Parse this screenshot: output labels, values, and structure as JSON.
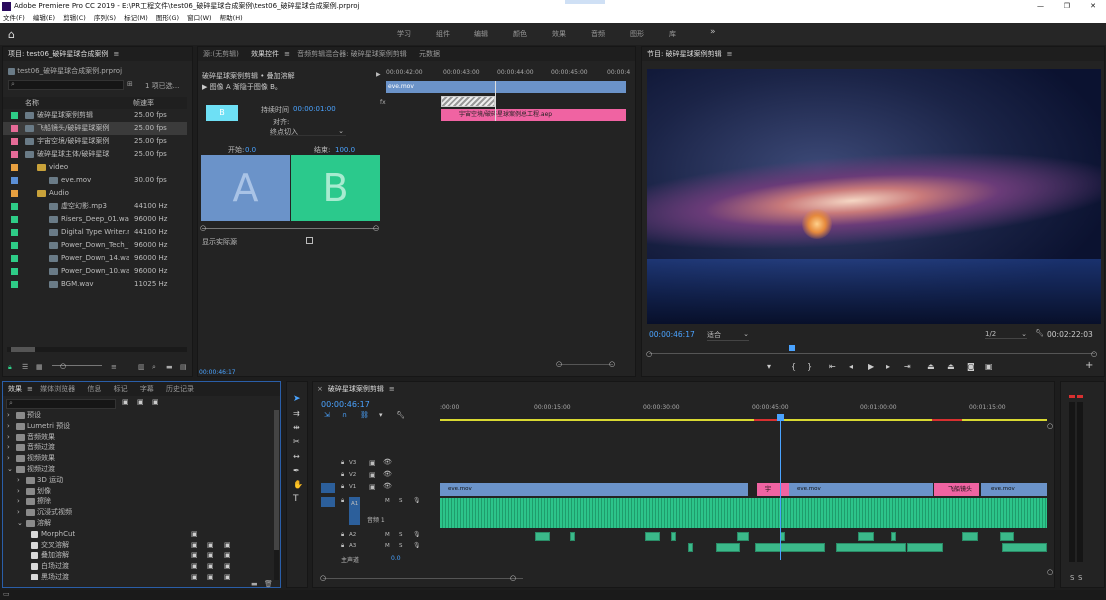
{
  "app": {
    "title": "Adobe Premiere Pro CC 2019 - E:\\PR工程文件\\test06_破碎星球合成案例\\test06_破碎星球合成案例.prproj"
  },
  "menu": [
    "文件(F)",
    "编辑(E)",
    "剪辑(C)",
    "序列(S)",
    "标记(M)",
    "图形(G)",
    "窗口(W)",
    "帮助(H)"
  ],
  "workspaces": [
    "学习",
    "组件",
    "编辑",
    "颜色",
    "效果",
    "音频",
    "图形",
    "库"
  ],
  "project": {
    "title": "项目: test06_破碎星球合成案例",
    "file": "test06_破碎星球合成案例.prproj",
    "count": "1 项已选...",
    "col_name": "名称",
    "col_rate": "帧速率",
    "items": [
      {
        "name": "破碎星球案例剪辑",
        "rate": "25.00 fps",
        "color": "#2ecc87",
        "indent": 0
      },
      {
        "name": "飞船镜头/破碎星球案例",
        "rate": "25.00 fps",
        "color": "#e66b98",
        "indent": 0,
        "selected": true
      },
      {
        "name": "宇宙空境/破碎星球案例",
        "rate": "25.00 fps",
        "color": "#e66b98",
        "indent": 0
      },
      {
        "name": "破碎星球主体/破碎星球",
        "rate": "25.00 fps",
        "color": "#e66b98",
        "indent": 0
      },
      {
        "name": "video",
        "rate": "",
        "color": "#e8a040",
        "indent": 1
      },
      {
        "name": "eve.mov",
        "rate": "30.00 fps",
        "color": "#5b8fd6",
        "indent": 2
      },
      {
        "name": "Audio",
        "rate": "",
        "color": "#e8a040",
        "indent": 1
      },
      {
        "name": "虚空幻影.mp3",
        "rate": "44100 Hz",
        "color": "#2ecc87",
        "indent": 2
      },
      {
        "name": "Risers_Deep_01.wav",
        "rate": "96000 Hz",
        "color": "#2ecc87",
        "indent": 2
      },
      {
        "name": "Digital Type Writer.mp3",
        "rate": "44100 Hz",
        "color": "#2ecc87",
        "indent": 2
      },
      {
        "name": "Power_Down_Tech_10",
        "rate": "96000 Hz",
        "color": "#2ecc87",
        "indent": 2
      },
      {
        "name": "Power_Down_14.wav",
        "rate": "96000 Hz",
        "color": "#2ecc87",
        "indent": 2
      },
      {
        "name": "Power_Down_10.wav",
        "rate": "96000 Hz",
        "color": "#2ecc87",
        "indent": 2
      },
      {
        "name": "BGM.wav",
        "rate": "11025 Hz",
        "color": "#2ecc87",
        "indent": 2
      }
    ]
  },
  "source": {
    "tabs": [
      "源:(无剪辑)",
      "效果控件",
      "音频剪辑混合器: 破碎星球案例剪辑",
      "元数据"
    ],
    "clip_path": "破碎星球案例剪辑 • 叠加溶解",
    "effect": "图像 A 渐隐于图像 B。",
    "duration_label": "持续时间",
    "duration": "00:00:01:00",
    "align_label": "对齐:",
    "align_value": "终点切入",
    "start_label": "开始:",
    "start_value": "0.0",
    "end_label": "结束:",
    "end_value": "100.0",
    "show_actual": "显示实际源",
    "a": "A",
    "b": "B",
    "b_small": "B",
    "timecode": "00:00:46:17",
    "ruler": [
      "00:00:42:00",
      "00:00:43:00",
      "00:00:44:00",
      "00:00:45:00",
      "00:00:4"
    ],
    "clip1": "eve.mov",
    "clip2": "宇宙空境/破碎星球案例总工程.aep"
  },
  "program": {
    "title": "节目: 破碎星球案例剪辑",
    "timecode": "00:00:46:17",
    "fit": "适合",
    "quality": "1/2",
    "duration": "00:02:22:03"
  },
  "effects": {
    "tabs": [
      "效果",
      "媒体浏览器",
      "信息",
      "标记",
      "字幕",
      "历史记录"
    ],
    "tree": [
      {
        "label": "预设",
        "level": 0,
        "open": false
      },
      {
        "label": "Lumetri 预设",
        "level": 0,
        "open": false
      },
      {
        "label": "音频效果",
        "level": 0,
        "open": false
      },
      {
        "label": "音频过渡",
        "level": 0,
        "open": false
      },
      {
        "label": "视频效果",
        "level": 0,
        "open": false
      },
      {
        "label": "视频过渡",
        "level": 0,
        "open": true
      },
      {
        "label": "3D 运动",
        "level": 1,
        "open": false
      },
      {
        "label": "划像",
        "level": 1,
        "open": false
      },
      {
        "label": "擦除",
        "level": 1,
        "open": false
      },
      {
        "label": "沉浸式视频",
        "level": 1,
        "open": false
      },
      {
        "label": "溶解",
        "level": 1,
        "open": true
      },
      {
        "label": "MorphCut",
        "level": 2,
        "item": true
      },
      {
        "label": "交叉溶解",
        "level": 2,
        "item": true
      },
      {
        "label": "叠加溶解",
        "level": 2,
        "item": true
      },
      {
        "label": "白场过渡",
        "level": 2,
        "item": true
      },
      {
        "label": "黑场过渡",
        "level": 2,
        "item": true
      }
    ]
  },
  "timeline": {
    "title": "破碎星球案例剪辑",
    "timecode": "00:00:46:17",
    "ruler": [
      ":00:00",
      "00:00:15:00",
      "00:00:30:00",
      "00:00:45:00",
      "00:01:00:00",
      "00:01:15:00"
    ],
    "tracks": [
      {
        "name": "V3"
      },
      {
        "name": "V2"
      },
      {
        "name": "V1"
      },
      {
        "name": "A1",
        "label": "音频 1"
      },
      {
        "name": "A2"
      },
      {
        "name": "A3"
      }
    ],
    "master_label": "主声道",
    "master_value": "0.0",
    "v1_clips": [
      "eve.mov",
      "宇",
      "eve.mov",
      "飞船镜头",
      "eve.mov"
    ],
    "m": "M",
    "s": "S"
  },
  "meter": {
    "s1": "S",
    "s2": "S"
  }
}
